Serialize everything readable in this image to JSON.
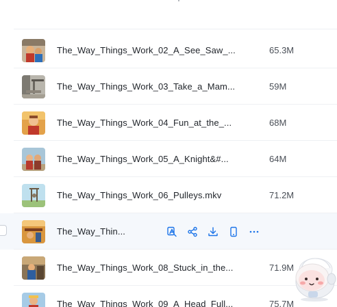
{
  "colors": {
    "accent": "#1a73e8",
    "text_primary": "#1f2329",
    "text_secondary": "#4a4f57",
    "hover_row": "#f5f8fc",
    "divider": "#eef0f3"
  },
  "files": [
    {
      "name": "The_Way_Things_Work_02_A_See_Saw_...",
      "size": "65.3M",
      "thumb_icon": "video-thumbnail-icon"
    },
    {
      "name": "The_Way_Things_Work_03_Take_a_Mam...",
      "size": "59M",
      "thumb_icon": "video-thumbnail-icon"
    },
    {
      "name": "The_Way_Things_Work_04_Fun_at_the_...",
      "size": "68M",
      "thumb_icon": "video-thumbnail-icon"
    },
    {
      "name": "The_Way_Things_Work_05_A_Knight&#...",
      "size": "64M",
      "thumb_icon": "video-thumbnail-icon"
    },
    {
      "name": "The_Way_Things_Work_06_Pulleys.mkv",
      "size": "71.2M",
      "thumb_icon": "video-thumbnail-icon"
    },
    {
      "name": "The_Way_Thin...",
      "size": "",
      "thumb_icon": "video-thumbnail-icon",
      "hovered": true
    },
    {
      "name": "The_Way_Things_Work_08_Stuck_in_the...",
      "size": "71.9M",
      "thumb_icon": "video-thumbnail-icon"
    },
    {
      "name": "The_Way_Things_Work_09_A_Head_Full...",
      "size": "75.7M",
      "thumb_icon": "video-thumbnail-icon"
    }
  ],
  "row_actions": [
    {
      "icon": "translate-icon"
    },
    {
      "icon": "share-icon"
    },
    {
      "icon": "download-icon"
    },
    {
      "icon": "phone-icon"
    },
    {
      "icon": "more-icon"
    }
  ],
  "assistant": {
    "icon": "assistant-mascot-icon"
  }
}
